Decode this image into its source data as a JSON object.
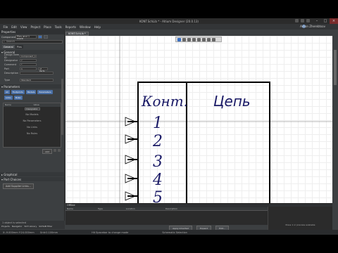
{
  "window": {
    "title": "KONT.SchLib * - Altium Designer (20.0.13)",
    "user": "Anton Zherebtsov"
  },
  "menubar": {
    "items": [
      "File",
      "Edit",
      "View",
      "Project",
      "Place",
      "Tools",
      "Reports",
      "Window",
      "Help"
    ]
  },
  "panel": {
    "title": "Properties",
    "component_label": "Component",
    "component_filter": "Pins and 1 more",
    "search_placeholder": "Search",
    "tabs": [
      "General",
      "Pins"
    ],
    "sections": {
      "general": "General",
      "parameters": "Parameters",
      "graphical": "Graphical",
      "part_choices": "Part Choices"
    },
    "general": {
      "design_item_id": {
        "label": "Design Item ID",
        "value": "Component_1"
      },
      "designator": {
        "label": "Designator",
        "value": "?"
      },
      "comment": {
        "label": "Comment",
        "value": "*"
      },
      "part": {
        "label": "Part",
        "value": "1",
        "extra": "of Parts"
      },
      "description": {
        "label": "Description",
        "value": ""
      },
      "type": {
        "label": "Type",
        "value": "Standard"
      }
    },
    "param_buttons": [
      "All",
      "Footprints",
      "Models",
      "Parameters",
      "Links",
      "Rules"
    ],
    "table_headers": [
      "Name",
      "Value"
    ],
    "table_cell": "Designator",
    "empty_rows": [
      "No Models",
      "No Parameters",
      "No Links",
      "No Rules"
    ],
    "add_label": "Add",
    "add_supplier": "Add Supplier Links...",
    "status": "1 object is selected",
    "bottom_tabs": [
      "Projects",
      "Navigator",
      "SCH Library",
      "SCHLIB Filter"
    ]
  },
  "document_tab": "KONT.SchLib *",
  "schematic": {
    "header_left": "Конт.",
    "header_right": "Цепь",
    "pin_numbers": [
      "1",
      "2",
      "3",
      "4",
      "5"
    ]
  },
  "messages": {
    "title": "Offline",
    "headers": [
      "Name",
      "Type",
      "Location",
      "Description"
    ],
    "buttons": [
      "Apply Inherited",
      "Expand",
      "Edit..."
    ],
    "right_info": "Press 1 or preview available"
  },
  "statusbar": {
    "coords": "X:-9.000mm Y:24.000mm",
    "grid": "Grid:0.100mm",
    "hint": "Hit Spacebar to change mode",
    "mode": "Schematic Selection"
  }
}
